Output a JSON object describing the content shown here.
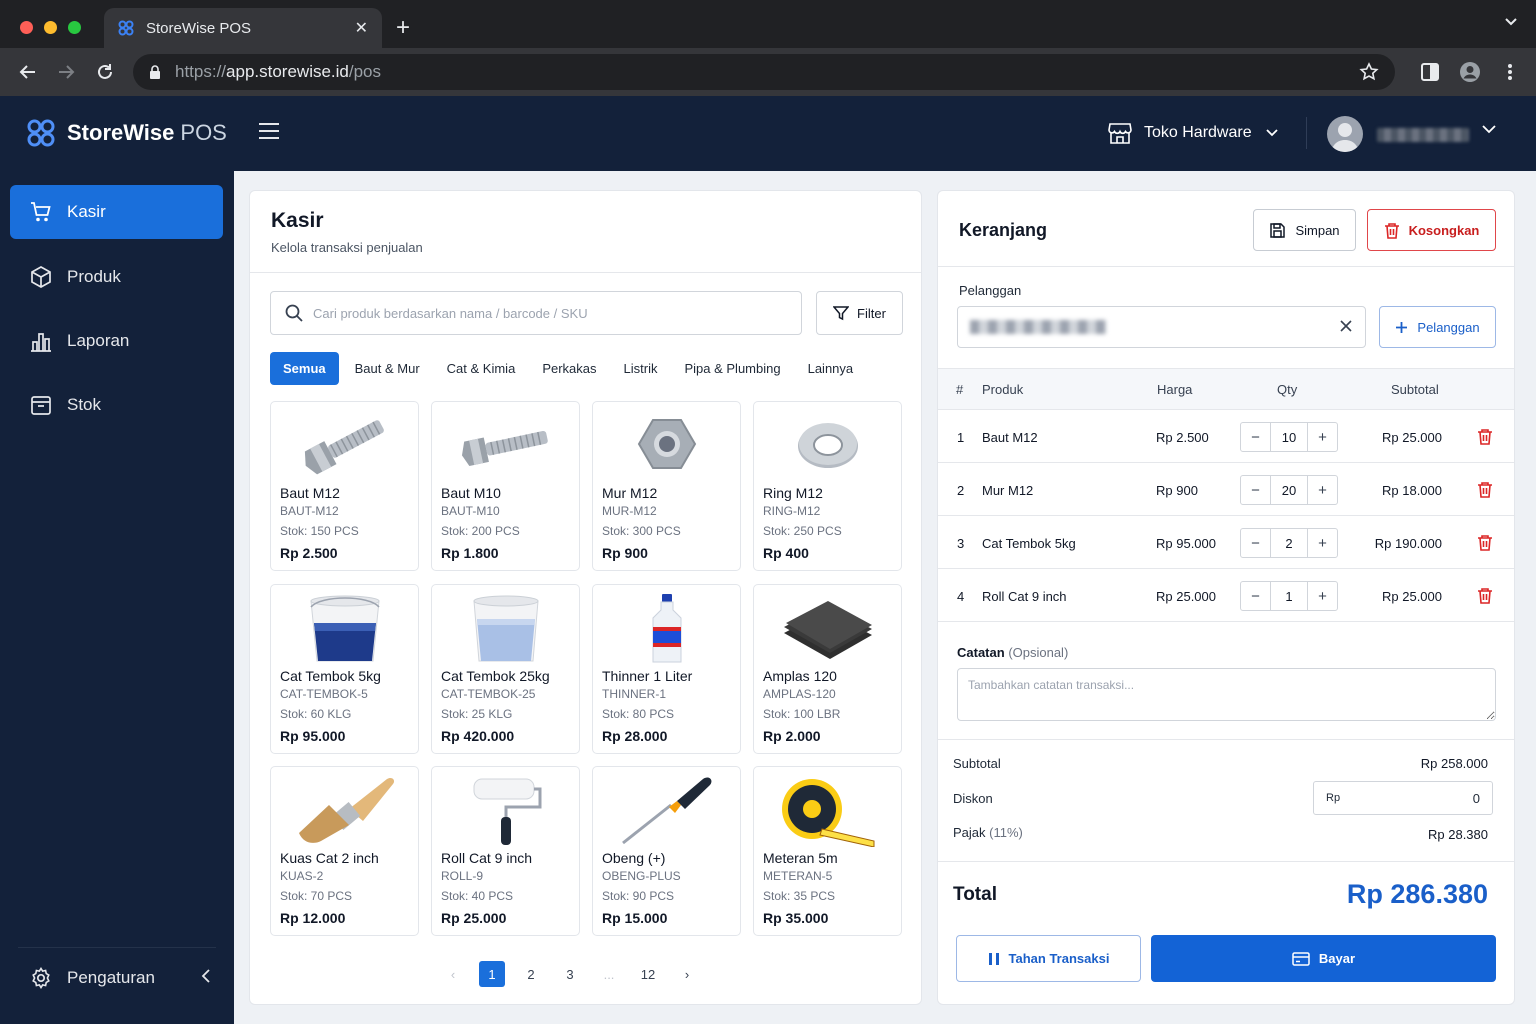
{
  "browser": {
    "tab_title": "StoreWise POS",
    "url_scheme": "https://",
    "url_host": "app.storewise.id",
    "url_path": "/pos"
  },
  "header": {
    "brand_bold": "StoreWise",
    "brand_light": "POS",
    "store_name": "Toko Hardware"
  },
  "sidebar": {
    "items": [
      {
        "label": "Kasir",
        "icon": "cart-icon"
      },
      {
        "label": "Produk",
        "icon": "box-icon"
      },
      {
        "label": "Laporan",
        "icon": "bar-chart-icon"
      },
      {
        "label": "Stok",
        "icon": "inventory-icon"
      }
    ],
    "settings_label": "Pengaturan"
  },
  "main": {
    "title": "Kasir",
    "subtitle": "Kelola transaksi penjualan",
    "search_placeholder": "Cari produk berdasarkan nama / barcode / SKU",
    "filter_label": "Filter",
    "categories": [
      "Semua",
      "Baut & Mur",
      "Cat & Kimia",
      "Perkakas",
      "Listrik",
      "Pipa & Plumbing",
      "Lainnya"
    ],
    "products": [
      {
        "name": "Baut M12",
        "sku": "BAUT-M12",
        "stock": "Stok: 150 PCS",
        "price": "Rp 2.500",
        "icon": "bolt"
      },
      {
        "name": "Baut M10",
        "sku": "BAUT-M10",
        "stock": "Stok: 200 PCS",
        "price": "Rp 1.800",
        "icon": "bolt"
      },
      {
        "name": "Mur M12",
        "sku": "MUR-M12",
        "stock": "Stok: 300 PCS",
        "price": "Rp 900",
        "icon": "nut"
      },
      {
        "name": "Ring M12",
        "sku": "RING-M12",
        "stock": "Stok: 250 PCS",
        "price": "Rp 400",
        "icon": "washer"
      },
      {
        "name": "Cat Tembok 5kg",
        "sku": "CAT-TEMBOK-5",
        "stock": "Stok: 60 KLG",
        "price": "Rp 95.000",
        "icon": "paint-bucket"
      },
      {
        "name": "Cat Tembok 25kg",
        "sku": "CAT-TEMBOK-25",
        "stock": "Stok: 25 KLG",
        "price": "Rp 420.000",
        "icon": "paint-bucket-light"
      },
      {
        "name": "Thinner 1 Liter",
        "sku": "THINNER-1",
        "stock": "Stok: 80 PCS",
        "price": "Rp 28.000",
        "icon": "bottle"
      },
      {
        "name": "Amplas 120",
        "sku": "AMPLAS-120",
        "stock": "Stok: 100 LBR",
        "price": "Rp 2.000",
        "icon": "sandpaper"
      },
      {
        "name": "Kuas Cat 2 inch",
        "sku": "KUAS-2",
        "stock": "Stok: 70 PCS",
        "price": "Rp 12.000",
        "icon": "brush"
      },
      {
        "name": "Roll Cat 9 inch",
        "sku": "ROLL-9",
        "stock": "Stok: 40 PCS",
        "price": "Rp 25.000",
        "icon": "roller"
      },
      {
        "name": "Obeng (+)",
        "sku": "OBENG-PLUS",
        "stock": "Stok: 90 PCS",
        "price": "Rp 15.000",
        "icon": "screwdriver"
      },
      {
        "name": "Meteran 5m",
        "sku": "METERAN-5",
        "stock": "Stok: 35 PCS",
        "price": "Rp 35.000",
        "icon": "tape-measure"
      }
    ],
    "pagination": {
      "pages": [
        "1",
        "2",
        "3",
        "...",
        "12"
      ],
      "current": "1"
    }
  },
  "cart": {
    "title": "Keranjang",
    "save_label": "Simpan",
    "clear_label": "Kosongkan",
    "customer_label": "Pelanggan",
    "add_customer_label": "Pelanggan",
    "columns": [
      "#",
      "Produk",
      "Harga",
      "Qty",
      "Subtotal"
    ],
    "items": [
      {
        "no": "1",
        "product": "Baut M12",
        "price": "Rp 2.500",
        "qty": "10",
        "subtotal": "Rp 25.000"
      },
      {
        "no": "2",
        "product": "Mur M12",
        "price": "Rp 900",
        "qty": "20",
        "subtotal": "Rp 18.000"
      },
      {
        "no": "3",
        "product": "Cat Tembok 5kg",
        "price": "Rp 95.000",
        "qty": "2",
        "subtotal": "Rp 190.000"
      },
      {
        "no": "4",
        "product": "Roll Cat 9 inch",
        "price": "Rp 25.000",
        "qty": "1",
        "subtotal": "Rp 25.000"
      }
    ],
    "note_label": "Catatan",
    "note_optional": "(Opsional)",
    "note_placeholder": "Tambahkan catatan transaksi...",
    "subtotal_label": "Subtotal",
    "subtotal_value": "Rp 258.000",
    "discount_label": "Diskon",
    "discount_prefix": "Rp",
    "discount_value": "0",
    "tax_label": "Pajak",
    "tax_rate": "(11%)",
    "tax_value": "Rp 28.380",
    "total_label": "Total",
    "total_value": "Rp 286.380",
    "hold_label": "Tahan Transaksi",
    "pay_label": "Bayar"
  },
  "colors": {
    "primary": "#1a6fdb",
    "danger": "#dc2626",
    "sidebar": "#13213a",
    "total": "#1a5fc9"
  }
}
